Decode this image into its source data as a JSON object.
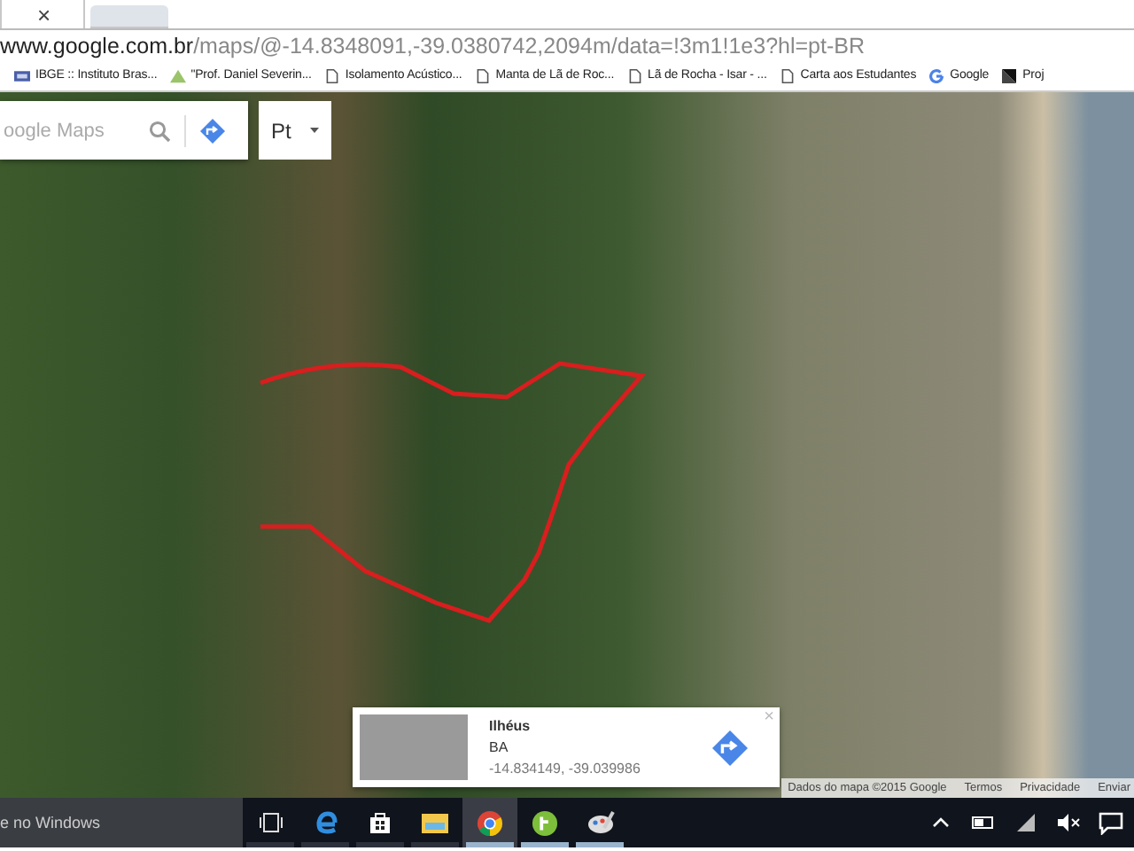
{
  "browser": {
    "tabs": [
      {
        "close": "×",
        "selected": true
      },
      {
        "selected": false
      }
    ],
    "address": {
      "host": "www.google.com.br",
      "path": "/maps/@-14.8348091,-39.0380742,2094m/data=!3m1!1e3?hl=pt-BR"
    },
    "bookmarks": [
      {
        "kind": "site",
        "label": "IBGE :: Instituto Bras..."
      },
      {
        "kind": "leaf",
        "label": "\"Prof. Daniel Severin..."
      },
      {
        "kind": "page",
        "label": "Isolamento Acústico..."
      },
      {
        "kind": "page",
        "label": "Manta de Lã de Roc..."
      },
      {
        "kind": "page",
        "label": "Lã de Rocha - Isar - ..."
      },
      {
        "kind": "page",
        "label": "Carta aos Estudantes"
      },
      {
        "kind": "google",
        "label": "Google"
      },
      {
        "kind": "dark",
        "label": "Proj"
      }
    ]
  },
  "map": {
    "search": {
      "placeholder": "oogle Maps"
    },
    "language": "Pt",
    "place_card": {
      "title": "Ilhéus",
      "subtitle": "BA",
      "coordinates": "-14.834149, -39.039986",
      "close": "×"
    },
    "attribution": [
      "Dados do mapa ©2015 Google",
      "Termos",
      "Privacidade",
      "Enviar"
    ]
  },
  "taskbar": {
    "search_text": "e no Windows",
    "apps": [
      {
        "kind": "taskview",
        "selected": false,
        "running": false
      },
      {
        "kind": "edge",
        "selected": false,
        "running": false
      },
      {
        "kind": "store",
        "selected": false,
        "running": false
      },
      {
        "kind": "explorer",
        "selected": false,
        "running": false
      },
      {
        "kind": "chrome",
        "selected": true,
        "running": true
      },
      {
        "kind": "green",
        "selected": false,
        "running": true
      },
      {
        "kind": "paint",
        "selected": false,
        "running": true
      }
    ]
  }
}
